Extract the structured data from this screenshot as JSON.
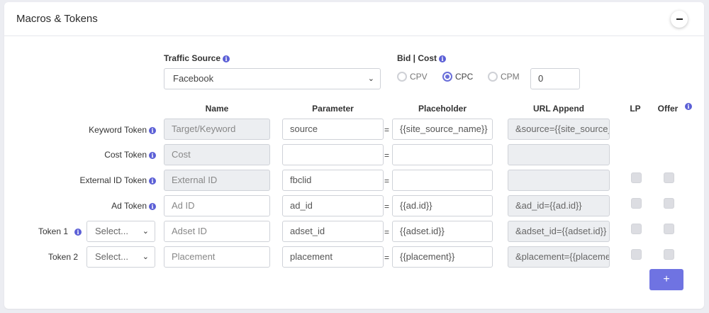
{
  "panel": {
    "title": "Macros & Tokens"
  },
  "traffic_source": {
    "label": "Traffic Source",
    "value": "Facebook"
  },
  "bid_cost": {
    "label": "Bid | Cost",
    "options": [
      {
        "label": "CPV",
        "selected": false
      },
      {
        "label": "CPC",
        "selected": true
      },
      {
        "label": "CPM",
        "selected": false
      }
    ],
    "value": "0"
  },
  "columns": {
    "name": "Name",
    "parameter": "Parameter",
    "placeholder": "Placeholder",
    "url_append": "URL Append",
    "lp": "LP",
    "offer": "Offer"
  },
  "rows": [
    {
      "label": "Keyword Token",
      "select": "",
      "name": "",
      "name_placeholder": "Target/Keyword",
      "parameter": "source",
      "placeholder": "{{site_source_name}}",
      "url_append": "&source={{site_source_name}}"
    },
    {
      "label": "Cost Token",
      "select": "",
      "name": "",
      "name_placeholder": "Cost",
      "parameter": "",
      "placeholder": "",
      "url_append": ""
    },
    {
      "label": "External ID Token",
      "select": "",
      "name": "",
      "name_placeholder": "External ID",
      "parameter": "fbclid",
      "placeholder": "",
      "url_append": ""
    },
    {
      "label": "Ad Token",
      "select": "",
      "name": "",
      "name_placeholder": "Ad ID",
      "parameter": "ad_id",
      "placeholder": "{{ad.id}}",
      "url_append": "&ad_id={{ad.id}}"
    },
    {
      "label": "Token 1",
      "select": "Select...",
      "name": "",
      "name_placeholder": "Adset ID",
      "parameter": "adset_id",
      "placeholder": "{{adset.id}}",
      "url_append": "&adset_id={{adset.id}}"
    },
    {
      "label": "Token 2",
      "select": "Select...",
      "name": "",
      "name_placeholder": "Placement",
      "parameter": "placement",
      "placeholder": "{{placement}}",
      "url_append": "&placement={{placement}}"
    }
  ],
  "equals_sign": "=",
  "add_button": "+",
  "colors": {
    "accent": "#6f73e2",
    "info_icon": "#5b5fd6"
  }
}
